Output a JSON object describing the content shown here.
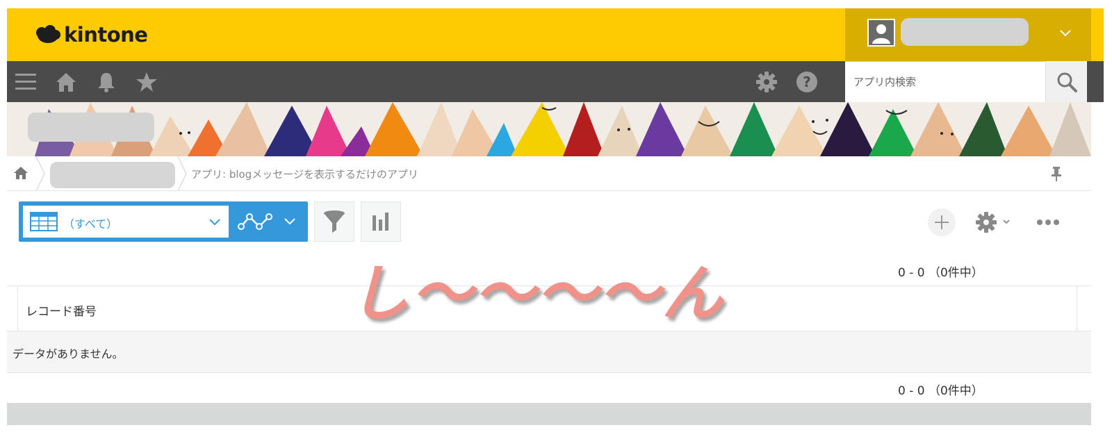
{
  "header": {
    "logo_text": "kintone",
    "logo_icon": "cloud-icon",
    "user": {
      "avatar_icon": "user-avatar-icon",
      "menu_icon": "chevron-down-icon"
    }
  },
  "nav": {
    "icons": [
      "menu-icon",
      "home-icon",
      "bell-icon",
      "star-icon",
      "gear-icon",
      "help-icon"
    ],
    "search": {
      "placeholder": "アプリ内検索",
      "value": "",
      "button_icon": "search-icon"
    }
  },
  "breadcrumb": {
    "home_icon": "home-icon",
    "app_label": "アプリ: blogメッセージを表示するだけのアプリ",
    "pin_icon": "pin-icon"
  },
  "toolbar": {
    "view_label": "（すべて）",
    "view_icon": "table-view-icon",
    "graph_icon": "graph-icon",
    "filter_icon": "filter-icon",
    "chart_icon": "bar-chart-icon",
    "add_icon": "plus-icon",
    "settings_icon": "gear-icon",
    "more_icon": "more-icon"
  },
  "pagination": {
    "top": "0 - 0 （0件中）",
    "bottom": "0 - 0 （0件中）"
  },
  "table": {
    "columns": [
      "レコード番号"
    ],
    "empty_message": "データがありません。"
  },
  "overlay_text": "し〜〜〜〜ん",
  "colors": {
    "header_yellow": "#fecb02",
    "user_area": "#d9ae02",
    "nav_dark": "#4b4b4b",
    "accent_blue": "#3498db",
    "overlay_pink": "#f0928a"
  }
}
